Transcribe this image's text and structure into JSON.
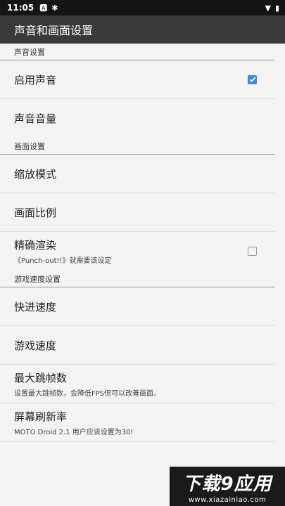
{
  "status_bar": {
    "time": "11:05",
    "notification_icons": [
      "a-icon",
      "bug-icon"
    ],
    "system_icons": [
      "wifi-icon",
      "battery-icon"
    ]
  },
  "app_bar": {
    "title": "声音和画面设置"
  },
  "sections": [
    {
      "header": "声音设置",
      "items": [
        {
          "title": "启用声音",
          "summary": "",
          "checkbox": true,
          "checked": true
        },
        {
          "title": "声音音量",
          "summary": "",
          "checkbox": false
        }
      ]
    },
    {
      "header": "画面设置",
      "items": [
        {
          "title": "缩放模式",
          "summary": "",
          "checkbox": false
        },
        {
          "title": "画面比例",
          "summary": "",
          "checkbox": false
        },
        {
          "title": "精确渲染",
          "summary": "《Punch-out!!》就需要该设定",
          "checkbox": true,
          "checked": false
        }
      ]
    },
    {
      "header": "游戏速度设置",
      "items": [
        {
          "title": "快进速度",
          "summary": "",
          "checkbox": false
        },
        {
          "title": "游戏速度",
          "summary": "",
          "checkbox": false
        },
        {
          "title": "最大跳帧数",
          "summary": "设置最大跳帧数，会降低FPS但可以改善画面。",
          "checkbox": false
        },
        {
          "title": "屏幕刷新率",
          "summary": "MOTO Droid 2.1 用户应该设置为30!",
          "checkbox": false
        }
      ]
    }
  ],
  "watermark": {
    "title": "下载9应用",
    "url": "www.xiazainiao.com"
  },
  "colors": {
    "accent": "#3b8bd9",
    "app_bar": "#3a3a3a",
    "status_bar": "#151515",
    "background": "#f3f3f3"
  }
}
